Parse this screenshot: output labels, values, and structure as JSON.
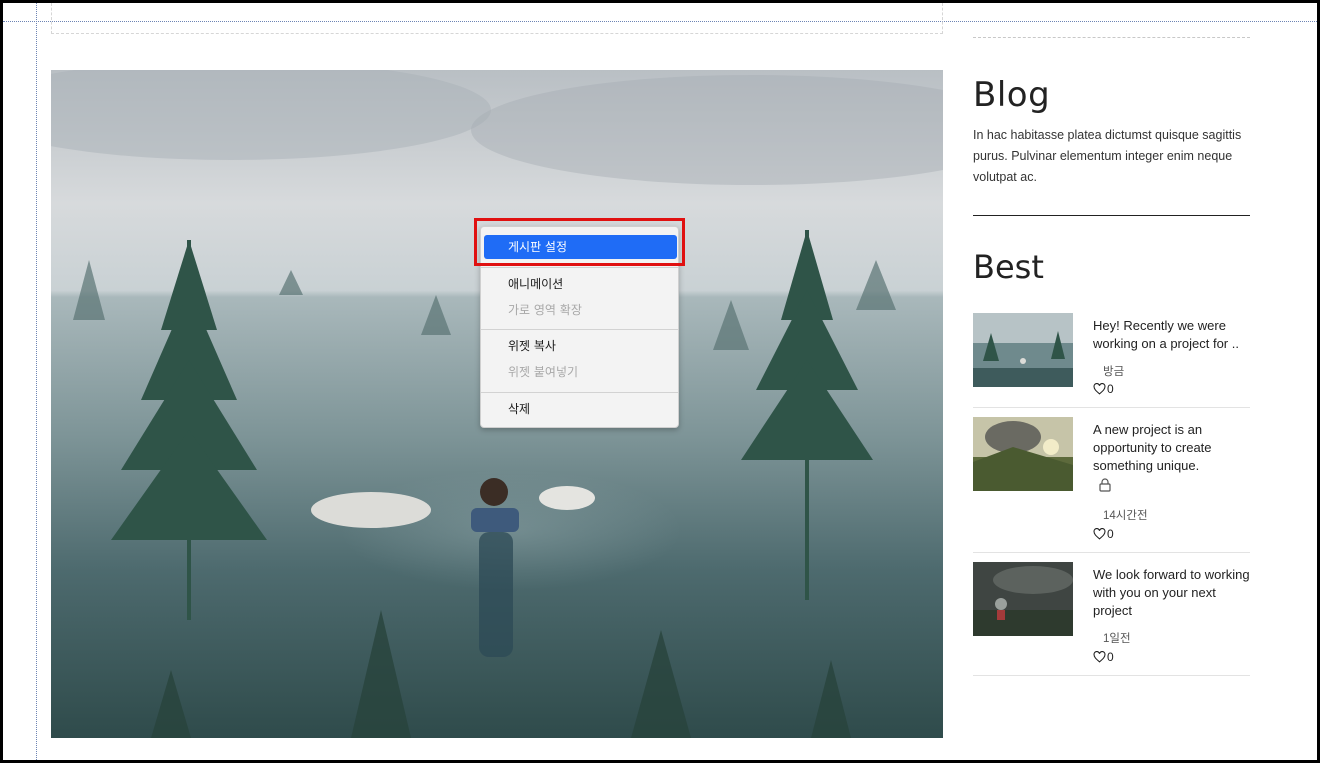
{
  "context_menu": {
    "items": [
      {
        "label": "게시판 설정",
        "state": "selected"
      },
      {
        "label": "애니메이션",
        "state": "enabled"
      },
      {
        "label": "가로 영역 확장",
        "state": "disabled"
      },
      {
        "label": "위젯 복사",
        "state": "enabled"
      },
      {
        "label": "위젯 붙여넣기",
        "state": "disabled"
      },
      {
        "label": "삭제",
        "state": "enabled"
      }
    ],
    "highlight_color": "#e01010",
    "selected_color": "#1f6cf6"
  },
  "sidebar": {
    "blog_title": "Blog",
    "blog_description": "In hac habitasse platea dictumst quisque sagittis purus. Pulvinar elementum integer enim neque volutpat ac.",
    "best_title": "Best",
    "posts": [
      {
        "title": "Hey! Recently we were working on a project for ..",
        "time": "방금",
        "likes": "0",
        "locked": false
      },
      {
        "title": "A new project is an opportunity to create something unique.",
        "time": "14시간전",
        "likes": "0",
        "locked": true
      },
      {
        "title": "We look forward to working with you on your next project",
        "time": "1일전",
        "likes": "0",
        "locked": false
      }
    ]
  },
  "icons": {
    "like": "heart-outline-icon",
    "lock": "lock-icon"
  }
}
